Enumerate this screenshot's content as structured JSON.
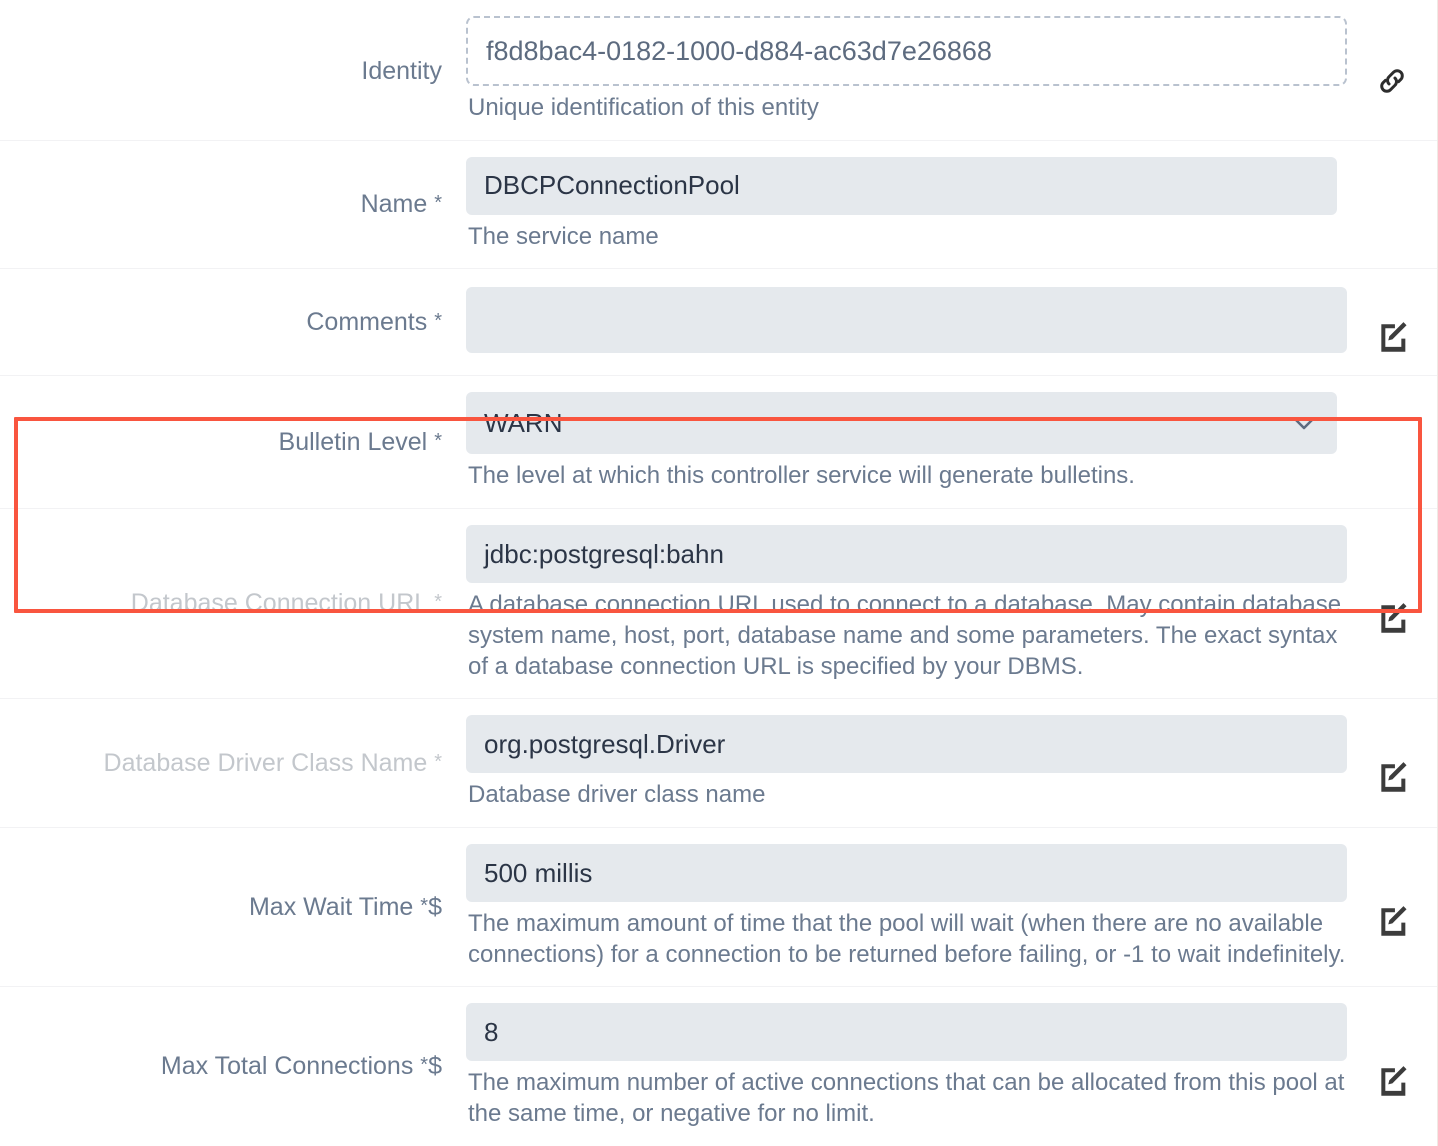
{
  "rows": [
    {
      "label": "Identity",
      "required": false,
      "dollar": false,
      "value": "f8d8bac4-0182-1000-d884-ac63d7e26868",
      "description": "Unique identification of this entity",
      "field_style": "dashed",
      "icon": "link-icon",
      "dimmed_label": false
    },
    {
      "label": "Name",
      "required": true,
      "dollar": false,
      "value": "DBCPConnectionPool",
      "description": "The service name",
      "field_style": "filled",
      "icon": "none",
      "dimmed_label": false
    },
    {
      "label": "Comments",
      "required": true,
      "dollar": false,
      "value": "",
      "description": "",
      "field_style": "filled-tall",
      "icon": "edit-icon",
      "dimmed_label": false
    },
    {
      "label": "Bulletin Level",
      "required": true,
      "dollar": false,
      "value": "WARN",
      "description": "The level at which this controller service will generate bulletins.",
      "field_style": "select",
      "icon": "none",
      "dimmed_label": false
    },
    {
      "label": "Database Connection URL",
      "required": true,
      "dollar": false,
      "value": "jdbc:postgresql:bahn",
      "description": "A database connection URL used to connect to a database. May contain database system name, host, port, database name and some parameters. The exact syntax of a database connection URL is specified by your DBMS.",
      "field_style": "filled",
      "icon": "edit-icon",
      "dimmed_label": true
    },
    {
      "label": "Database Driver Class Name",
      "required": true,
      "dollar": false,
      "value": "org.postgresql.Driver",
      "description": "Database driver class name",
      "field_style": "filled",
      "icon": "edit-icon",
      "dimmed_label": true
    },
    {
      "label": "Max Wait Time",
      "required": true,
      "dollar": true,
      "value": "500 millis",
      "description": "The maximum amount of time that the pool will wait (when there are no available connections) for a connection to be returned before failing, or -1 to wait indefinitely.",
      "field_style": "filled",
      "icon": "edit-icon",
      "dimmed_label": false
    },
    {
      "label": "Max Total Connections",
      "required": true,
      "dollar": true,
      "value": "8",
      "description": "The maximum number of active connections that can be allocated from this pool at the same time, or negative for no limit.",
      "field_style": "filled",
      "icon": "edit-icon",
      "dimmed_label": false
    }
  ],
  "highlight": {
    "color": "#f9553f",
    "covers": [
      "Database Connection URL",
      "Database Driver Class Name"
    ]
  },
  "markers": {
    "required": "*",
    "expression_language": "$"
  }
}
